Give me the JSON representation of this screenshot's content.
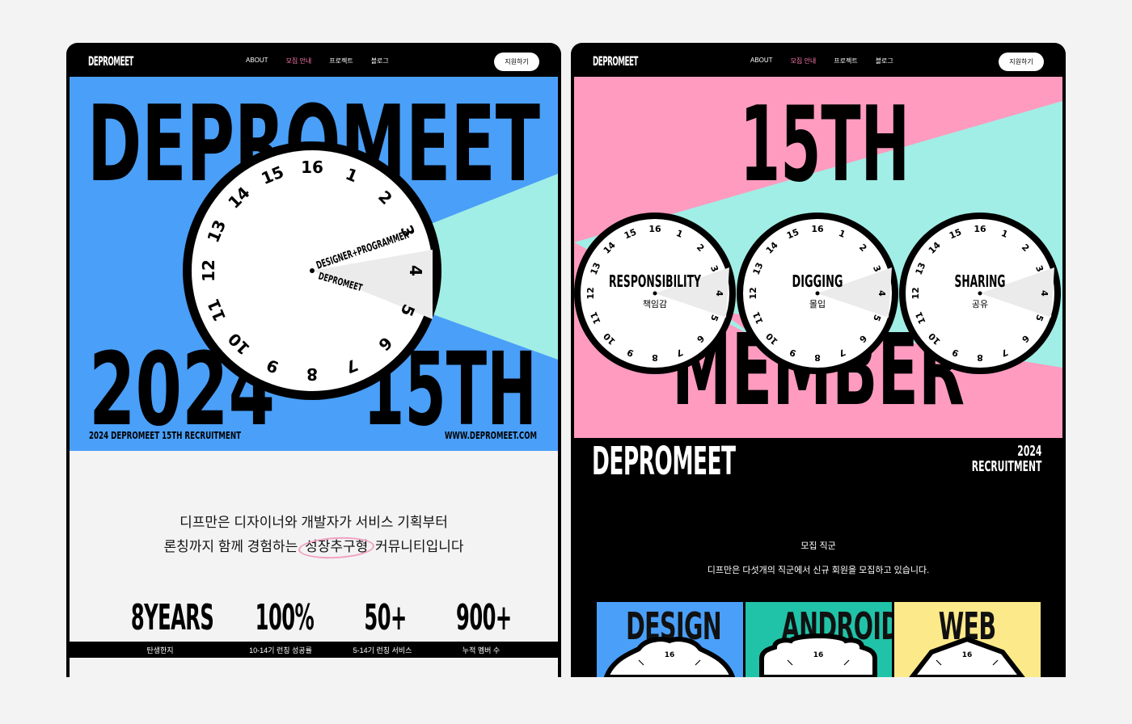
{
  "left": {
    "nav": {
      "logo": "DEPROMEET",
      "links": [
        "ABOUT",
        "모집 안내",
        "프로젝트",
        "블로그"
      ],
      "active_index": 1,
      "apply": "지원하기"
    },
    "hero": {
      "title_top": "DEPROMEET",
      "title_bottom_left": "2024",
      "title_bottom_right": "15TH",
      "caption_left": "2024 DEPROMEET 15TH RECRUITMENT",
      "caption_right": "WWW.DEPROMEET.COM",
      "clock_numbers": [
        "16",
        "1",
        "2",
        "3",
        "4",
        "5",
        "6",
        "7",
        "8",
        "9",
        "10",
        "11",
        "12",
        "13",
        "14",
        "15"
      ],
      "hand_label_long": "DESIGNER+PROGRAMMER",
      "hand_label_short": "DEPROMEET"
    },
    "intro": {
      "line1": "디프만은 디자이너와 개발자가 서비스 기획부터",
      "line2_before": "론칭까지 함께 경험하는",
      "line2_highlight": "성장추구형",
      "line2_after": "커뮤니티입니다"
    },
    "stats": [
      {
        "value": "8YEARS",
        "label": "탄생한지"
      },
      {
        "value": "100%",
        "label": "10-14기 런칭 성공률"
      },
      {
        "value": "50+",
        "label": "5-14기 런칭 서비스"
      },
      {
        "value": "900+",
        "label": "누적 멤버 수"
      }
    ]
  },
  "right": {
    "nav": {
      "logo": "DEPROMEET",
      "links": [
        "ABOUT",
        "모집 안내",
        "프로젝트",
        "블로그"
      ],
      "active_index": 1,
      "apply": "지원하기"
    },
    "hero": {
      "title_top": "15TH",
      "title_bottom": "MEMBER",
      "clocks": [
        {
          "title": "RESPONSIBILITY",
          "subtitle": "책임감"
        },
        {
          "title": "DIGGING",
          "subtitle": "몰입"
        },
        {
          "title": "SHARING",
          "subtitle": "공유"
        }
      ],
      "clock_numbers": [
        "16",
        "1",
        "2",
        "3",
        "4",
        "5",
        "6",
        "7",
        "8",
        "9",
        "10",
        "11",
        "12",
        "13",
        "14",
        "15"
      ]
    },
    "brand": {
      "logo": "DEPROMEET",
      "year": "2024",
      "recruitment": "RECRUITMENT"
    },
    "roles": {
      "title": "모집 직군",
      "description": "디프만은 다섯개의 직군에서 신규 회원을 모집하고 있습니다.",
      "cards": [
        {
          "name": "DESIGN",
          "color": "#4a9ff8",
          "clock_number": "16"
        },
        {
          "name": "ANDROID",
          "color": "#20c3a8",
          "clock_number": "16"
        },
        {
          "name": "WEB",
          "color": "#fce98a",
          "clock_number": "16"
        }
      ]
    }
  },
  "colors": {
    "blue": "#4a9ff8",
    "mint": "#a1eee6",
    "pink": "#fe9bbf",
    "black": "#000000",
    "nav_active": "#ff79b0"
  }
}
